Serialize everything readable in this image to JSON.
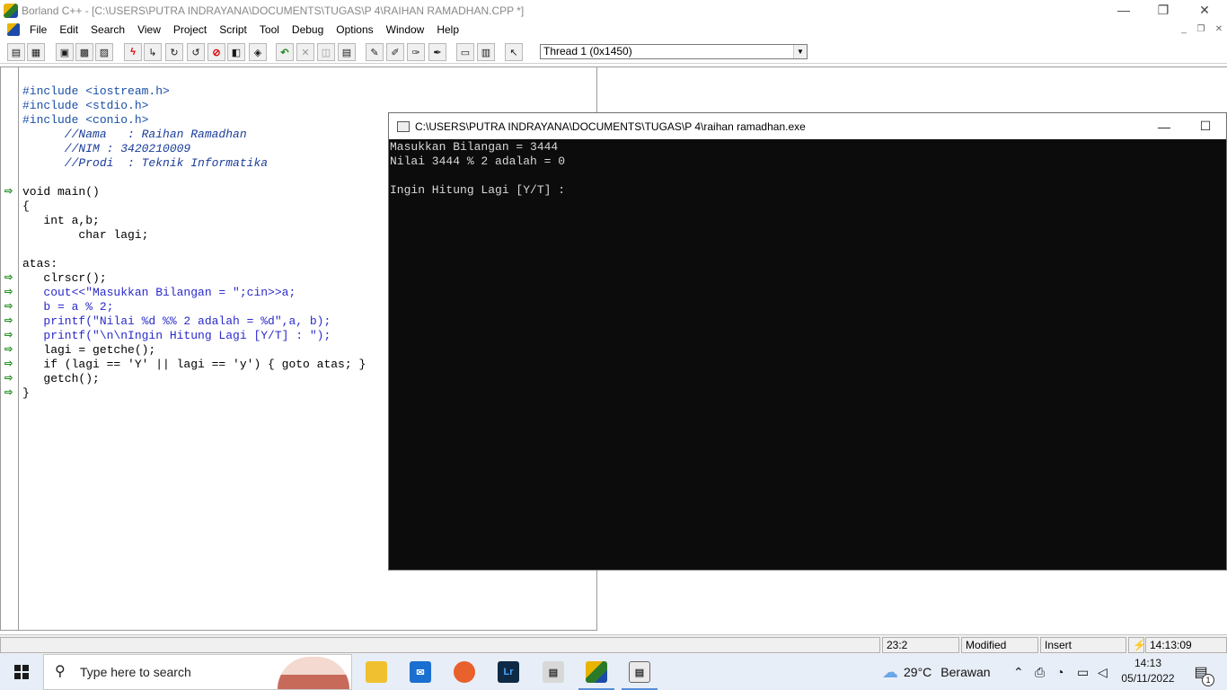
{
  "window": {
    "title": "Borland C++ - [C:\\USERS\\PUTRA INDRAYANA\\DOCUMENTS\\TUGAS\\P 4\\RAIHAN RAMADHAN.CPP *]",
    "minimize": "—",
    "restore": "❐",
    "close": "✕"
  },
  "menu": {
    "items": [
      "File",
      "Edit",
      "Search",
      "View",
      "Project",
      "Script",
      "Tool",
      "Debug",
      "Options",
      "Window",
      "Help"
    ],
    "mdi_minimize": "_",
    "mdi_restore": "❐",
    "mdi_close": "✕"
  },
  "toolbar": {
    "thread_value": "Thread 1 (0x1450)",
    "thread_arrow": "▼"
  },
  "editor": {
    "lines": [
      "#include <iostream.h>",
      "#include <stdio.h>",
      "#include <conio.h>",
      "",
      "      //Nama   : Raihan Ramadhan",
      "      //NIM : 3420210009",
      "      //Prodi  : Teknik Informatika",
      "",
      "void main()",
      "{",
      "   int a,b;",
      "        char lagi;",
      "",
      "atas:",
      "   clrscr();",
      "   cout<<\"Masukkan Bilangan = \";cin>>a;",
      "   b = a % 2;",
      "   printf(\"Nilai %d %% 2 adalah = %d\",a, b);",
      "   printf(\"\\n\\nIngin Hitung Lagi [Y/T] : \");",
      "   lagi = getche();",
      "   if (lagi == 'Y' || lagi == 'y') { goto atas; }",
      "   getch();",
      "}"
    ],
    "breakpoint_glyph": "⇨"
  },
  "console": {
    "title": "C:\\USERS\\PUTRA INDRAYANA\\DOCUMENTS\\TUGAS\\P 4\\raihan ramadhan.exe",
    "minimize": "—",
    "maximize": "☐",
    "output": "Masukkan Bilangan = 3444\nNilai 3444 % 2 adalah = 0\n\nIngin Hitung Lagi [Y/T] : "
  },
  "statusbar": {
    "position": "23:2",
    "modified": "Modified",
    "mode": "Insert",
    "time": "14:13:09",
    "lightning": "⚡"
  },
  "taskbar": {
    "search_placeholder": "Type here to search",
    "weather_temp": "29°C",
    "weather_desc": "Berawan",
    "clock_time": "14:13",
    "clock_date": "05/11/2022",
    "notification_count": "1"
  },
  "colors": {
    "console_bg": "#0c0c0c",
    "console_text": "#d8d8d8",
    "taskbar_bg": "#e8eef7",
    "breakpoint_green": "#1f8a1f",
    "string_blue": "#2a2acc"
  }
}
